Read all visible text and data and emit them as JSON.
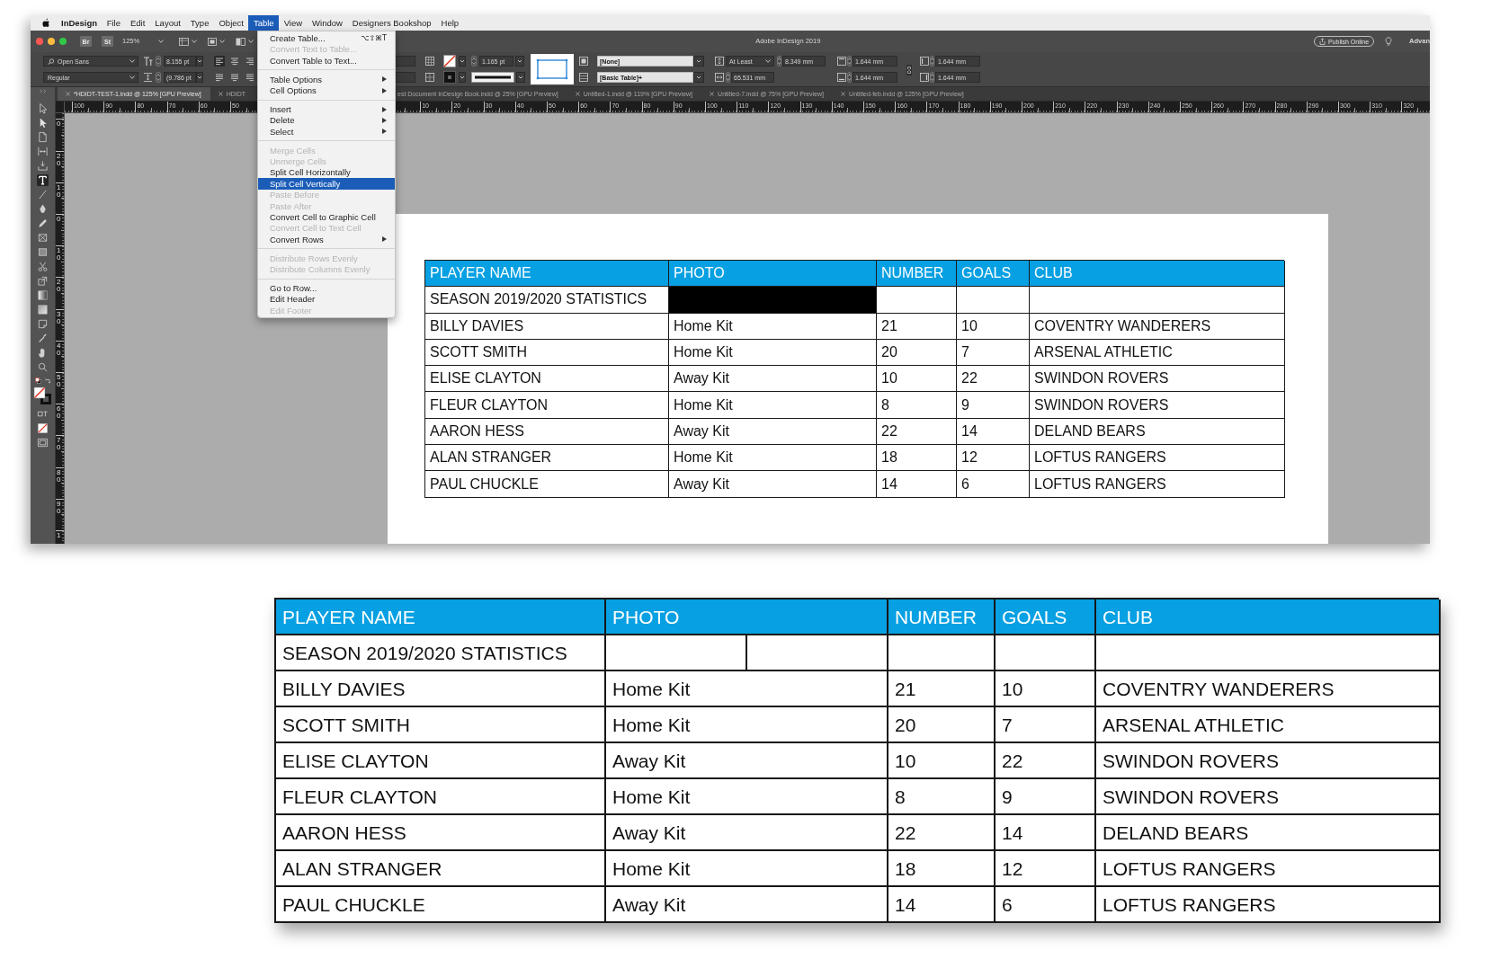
{
  "menu_bar": {
    "app_name": "InDesign",
    "items": [
      {
        "label": "File",
        "selected": false
      },
      {
        "label": "Edit",
        "selected": false
      },
      {
        "label": "Layout",
        "selected": false
      },
      {
        "label": "Type",
        "selected": false
      },
      {
        "label": "Object",
        "selected": false
      },
      {
        "label": "Table",
        "selected": true
      },
      {
        "label": "View",
        "selected": false
      },
      {
        "label": "Window",
        "selected": false
      },
      {
        "label": "Designers Bookshop",
        "selected": false
      },
      {
        "label": "Help",
        "selected": false
      }
    ]
  },
  "window": {
    "bridge_button": "Br",
    "stock_button": "St",
    "zoom": "125%",
    "title": "Adobe InDesign 2019",
    "publish_button": "Publish Online",
    "workspace": "Advan"
  },
  "control_panel": {
    "font_family": "Open Sans",
    "font_style": "Regular",
    "font_size": "8.155 pt",
    "leading": "(9.786 pt",
    "alignment_buttons": [
      {
        "kind": "align_left",
        "selected": true
      },
      {
        "kind": "align_center",
        "selected": false
      },
      {
        "kind": "align_right",
        "selected": false
      },
      {
        "kind": "justify_left",
        "selected": false
      },
      {
        "kind": "justify_center",
        "selected": false
      },
      {
        "kind": "justify_right",
        "selected": false
      }
    ],
    "stroke_weight": "1.165 pt",
    "cell_style": "[None]",
    "table_style": "[Basic Table]+",
    "row_height_mode": "At Least",
    "row_height": "8.349 mm",
    "column_width": "65.531 mm",
    "inset_top": "1.644 mm",
    "inset_bottom": "1.644 mm",
    "inset_left": "1.644 mm",
    "inset_right": "1.644 mm"
  },
  "document_tabs": [
    {
      "label": "*HDIDT-TEST-1.indd @ 125% [GPU Preview]",
      "selected": true,
      "close_button": true
    },
    {
      "label": "HDIDT",
      "selected": false,
      "close_button": true
    },
    {
      "label": "est Document InDesign Book.indd @ 25% [GPU Preview]",
      "selected": false,
      "close_button": false
    },
    {
      "label": "Untitled-1.indd @ 119% [GPU Preview]",
      "selected": false,
      "close_button": true
    },
    {
      "label": "Untitled-7.indd @ 75% [GPU Preview]",
      "selected": false,
      "close_button": true
    },
    {
      "label": "Untitled-feb.indd @ 125% [GPU Preview]",
      "selected": false,
      "close_button": true
    }
  ],
  "horizontal_ruler": {
    "left_labels": [
      "100",
      "90",
      "80",
      "70",
      "60",
      "50"
    ],
    "right_labels": [
      "10",
      "20",
      "30",
      "40",
      "50",
      "60",
      "70",
      "80",
      "90",
      "100",
      "110",
      "120",
      "130",
      "140",
      "150",
      "160",
      "170",
      "180",
      "190",
      "200",
      "210",
      "220",
      "230",
      "240",
      "250",
      "260",
      "270",
      "280",
      "290",
      "300",
      "310",
      "320"
    ]
  },
  "vertical_ruler": {
    "labels": [
      "0",
      "20",
      "10",
      "0",
      "10",
      "20",
      "30",
      "40",
      "50",
      "60",
      "70",
      "80",
      "90",
      "1"
    ]
  },
  "tools": [
    {
      "kind": "selection",
      "selected": false
    },
    {
      "kind": "direct_selection",
      "selected": false
    },
    {
      "kind": "page",
      "selected": false
    },
    {
      "kind": "gap",
      "selected": false
    },
    {
      "kind": "content_collector",
      "selected": false
    },
    {
      "kind": "type",
      "selected": true
    },
    {
      "kind": "line",
      "selected": false
    },
    {
      "kind": "pen",
      "selected": false
    },
    {
      "kind": "pencil",
      "selected": false
    },
    {
      "kind": "rectangle_frame",
      "selected": false
    },
    {
      "kind": "rectangle",
      "selected": false
    },
    {
      "kind": "scissors",
      "selected": false
    },
    {
      "kind": "free_transform",
      "selected": false
    },
    {
      "kind": "gradient_swatch",
      "selected": false
    },
    {
      "kind": "gradient_feather",
      "selected": false
    },
    {
      "kind": "note",
      "selected": false
    },
    {
      "kind": "eyedropper",
      "selected": false
    },
    {
      "kind": "hand",
      "selected": false
    },
    {
      "kind": "zoom",
      "selected": false
    },
    {
      "kind": "color_defaults",
      "selected": false
    },
    {
      "kind": "fill_stroke",
      "selected": false
    },
    {
      "kind": "formatting",
      "selected": false
    },
    {
      "kind": "apply_none",
      "selected": false
    },
    {
      "kind": "screen_mode",
      "selected": false
    }
  ],
  "table_menu": {
    "groups": [
      {
        "items": [
          {
            "label": "Create Table...",
            "shortcut": "⌥⇧⌘T",
            "submenu": false,
            "disabled": false,
            "selected": false
          },
          {
            "label": "Convert Text to Table...",
            "submenu": false,
            "disabled": true,
            "selected": false
          },
          {
            "label": "Convert Table to Text...",
            "submenu": false,
            "disabled": false,
            "selected": false
          }
        ]
      },
      {
        "items": [
          {
            "label": "Table Options",
            "submenu": true,
            "disabled": false,
            "selected": false
          },
          {
            "label": "Cell Options",
            "submenu": true,
            "disabled": false,
            "selected": false
          }
        ]
      },
      {
        "items": [
          {
            "label": "Insert",
            "submenu": true,
            "disabled": false,
            "selected": false
          },
          {
            "label": "Delete",
            "submenu": true,
            "disabled": false,
            "selected": false
          },
          {
            "label": "Select",
            "submenu": true,
            "disabled": false,
            "selected": false
          }
        ]
      },
      {
        "items": [
          {
            "label": "Merge Cells",
            "submenu": false,
            "disabled": true,
            "selected": false
          },
          {
            "label": "Unmerge Cells",
            "submenu": false,
            "disabled": true,
            "selected": false
          },
          {
            "label": "Split Cell Horizontally",
            "submenu": false,
            "disabled": false,
            "selected": false
          },
          {
            "label": "Split Cell Vertically",
            "submenu": false,
            "disabled": false,
            "selected": true
          },
          {
            "label": "Paste Before",
            "submenu": false,
            "disabled": true,
            "selected": false
          },
          {
            "label": "Paste After",
            "submenu": false,
            "disabled": true,
            "selected": false
          },
          {
            "label": "Convert Cell to Graphic Cell",
            "submenu": false,
            "disabled": false,
            "selected": false
          },
          {
            "label": "Convert Cell to Text Cell",
            "submenu": false,
            "disabled": true,
            "selected": false
          },
          {
            "label": "Convert Rows",
            "submenu": true,
            "disabled": false,
            "selected": false
          }
        ]
      },
      {
        "items": [
          {
            "label": "Distribute Rows Evenly",
            "submenu": false,
            "disabled": true,
            "selected": false
          },
          {
            "label": "Distribute Columns Evenly",
            "submenu": false,
            "disabled": true,
            "selected": false
          }
        ]
      },
      {
        "items": [
          {
            "label": "Go to Row...",
            "submenu": false,
            "disabled": false,
            "selected": false
          },
          {
            "label": "Edit Header",
            "submenu": false,
            "disabled": false,
            "selected": false
          },
          {
            "label": "Edit Footer",
            "submenu": false,
            "disabled": true,
            "selected": false
          }
        ]
      }
    ]
  },
  "document_table": {
    "columns": [
      "PLAYER NAME",
      "PHOTO",
      "NUMBER",
      "GOALS",
      "CLUB"
    ],
    "rows": [
      {
        "cells": [
          "SEASON 2019/2020 STATISTICS"
        ],
        "photo_selected": true
      },
      {
        "cells": [
          "BILLY DAVIES",
          "Home Kit",
          "21",
          "10",
          "COVENTRY WANDERERS"
        ],
        "photo_selected": false
      },
      {
        "cells": [
          "SCOTT SMITH",
          "Home Kit",
          "20",
          "7",
          "ARSENAL ATHLETIC"
        ],
        "photo_selected": false
      },
      {
        "cells": [
          "ELISE CLAYTON",
          "Away Kit",
          "10",
          "22",
          "SWINDON ROVERS"
        ],
        "photo_selected": false
      },
      {
        "cells": [
          "FLEUR CLAYTON",
          "Home Kit",
          "8",
          "9",
          "SWINDON ROVERS"
        ],
        "photo_selected": false
      },
      {
        "cells": [
          "AARON HESS",
          "Away Kit",
          "22",
          "14",
          "DELAND BEARS"
        ],
        "photo_selected": false
      },
      {
        "cells": [
          "ALAN STRANGER",
          "Home Kit",
          "18",
          "12",
          "LOFTUS RANGERS"
        ],
        "photo_selected": false
      },
      {
        "cells": [
          "PAUL CHUCKLE",
          "Away Kit",
          "14",
          "6",
          "LOFTUS RANGERS"
        ],
        "photo_selected": false
      }
    ]
  },
  "result_table": {
    "columns": [
      "PLAYER NAME",
      "PHOTO",
      "NUMBER",
      "GOALS",
      "CLUB"
    ],
    "rows": [
      {
        "cells": [
          "SEASON 2019/2020 STATISTICS"
        ],
        "photo_split": true
      },
      {
        "cells": [
          "BILLY DAVIES",
          "Home Kit",
          "21",
          "10",
          "COVENTRY WANDERERS"
        ],
        "photo_split": false
      },
      {
        "cells": [
          "SCOTT SMITH",
          "Home Kit",
          "20",
          "7",
          "ARSENAL ATHLETIC"
        ],
        "photo_split": false
      },
      {
        "cells": [
          "ELISE CLAYTON",
          "Away Kit",
          "10",
          "22",
          "SWINDON ROVERS"
        ],
        "photo_split": false
      },
      {
        "cells": [
          "FLEUR CLAYTON",
          "Home Kit",
          "8",
          "9",
          "SWINDON ROVERS"
        ],
        "photo_split": false
      },
      {
        "cells": [
          "AARON HESS",
          "Away Kit",
          "22",
          "14",
          "DELAND BEARS"
        ],
        "photo_split": false
      },
      {
        "cells": [
          "ALAN STRANGER",
          "Home Kit",
          "18",
          "12",
          "LOFTUS RANGERS"
        ],
        "photo_split": false
      },
      {
        "cells": [
          "PAUL CHUCKLE",
          "Away Kit",
          "14",
          "6",
          "LOFTUS RANGERS"
        ],
        "photo_split": false
      }
    ]
  }
}
